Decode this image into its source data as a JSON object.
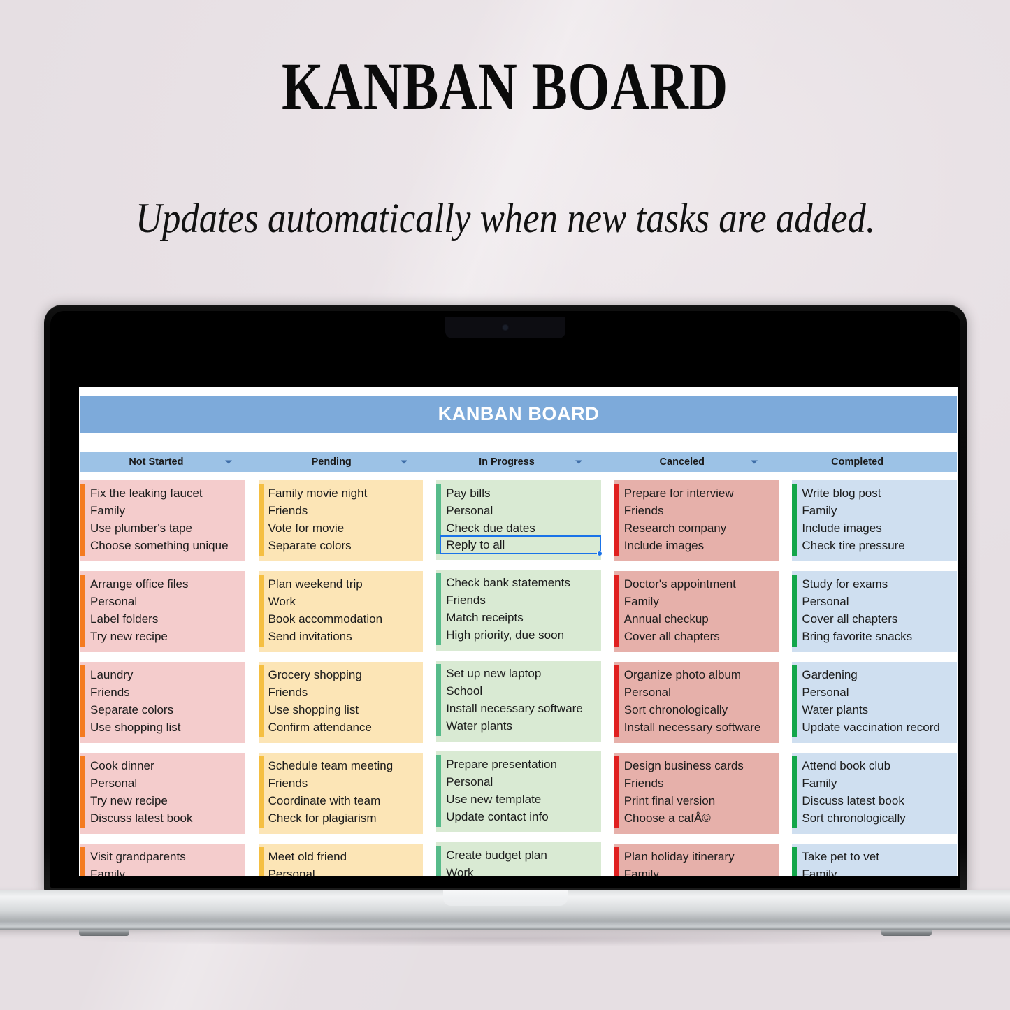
{
  "poster": {
    "title": "KANBAN BOARD",
    "subtitle": "Updates automatically when new tasks are added."
  },
  "device": {
    "type": "laptop",
    "camera_icon": "camera-dot"
  },
  "board": {
    "title": "KANBAN BOARD",
    "title_bar_color": "#7daada",
    "header_bar_color": "#9cc2e6",
    "columns": [
      {
        "name": "Not Started",
        "has_filter": true,
        "card_color": "#f4cccc",
        "accent_color": "#f47b20",
        "cards": [
          {
            "lines": [
              "Fix the leaking faucet",
              "Family",
              "Use plumber's tape",
              "Choose something unique"
            ]
          },
          {
            "lines": [
              "Arrange office files",
              "Personal",
              "Label folders",
              "Try new recipe"
            ]
          },
          {
            "lines": [
              "Laundry",
              "Friends",
              "Separate colors",
              "Use shopping list"
            ]
          },
          {
            "lines": [
              "Cook dinner",
              "Personal",
              "Try new recipe",
              "Discuss latest book"
            ]
          },
          {
            "lines": [
              "Visit grandparents",
              "Family"
            ]
          }
        ]
      },
      {
        "name": "Pending",
        "has_filter": true,
        "card_color": "#fce5b6",
        "accent_color": "#f5bf42",
        "cards": [
          {
            "lines": [
              "Family movie night",
              "Friends",
              "Vote for movie",
              "Separate colors"
            ]
          },
          {
            "lines": [
              "Plan weekend trip",
              "Work",
              "Book accommodation",
              "Send invitations"
            ]
          },
          {
            "lines": [
              "Grocery shopping",
              "Friends",
              "Use shopping list",
              "Confirm attendance"
            ]
          },
          {
            "lines": [
              "Schedule team meeting",
              "Friends",
              "Coordinate with team",
              "Check for plagiarism"
            ]
          },
          {
            "lines": [
              "Meet old friend",
              "Personal"
            ]
          }
        ]
      },
      {
        "name": "In Progress",
        "has_filter": true,
        "card_color": "#d9ead3",
        "accent_color": "#57bb8a",
        "cards": [
          {
            "lines": [
              "Pay bills",
              "Personal",
              "Check due dates",
              "Reply to all"
            ],
            "selected_line": 3
          },
          {
            "lines": [
              "Check bank statements",
              "Friends",
              "Match receipts",
              "High priority, due soon"
            ]
          },
          {
            "lines": [
              "Set up new laptop",
              "School",
              "Install necessary software",
              "Water plants"
            ]
          },
          {
            "lines": [
              "Prepare presentation",
              "Personal",
              "Use new template",
              "Update contact info"
            ]
          },
          {
            "lines": [
              "Create budget plan",
              "Work"
            ]
          }
        ]
      },
      {
        "name": "Canceled",
        "has_filter": true,
        "card_color": "#e6b0aa",
        "accent_color": "#e02020",
        "cards": [
          {
            "lines": [
              "Prepare for interview",
              "Friends",
              "Research company",
              "Include images"
            ]
          },
          {
            "lines": [
              "Doctor's appointment",
              "Family",
              "Annual checkup",
              "Cover all chapters"
            ]
          },
          {
            "lines": [
              "Organize photo album",
              "Personal",
              "Sort chronologically",
              "Install necessary software"
            ]
          },
          {
            "lines": [
              "Design business cards",
              "Friends",
              "Print final version",
              "Choose a cafÅ©"
            ]
          },
          {
            "lines": [
              "Plan holiday itinerary",
              "Family"
            ]
          }
        ]
      },
      {
        "name": "Completed",
        "has_filter": false,
        "card_color": "#cfdff0",
        "accent_color": "#13a64a",
        "cards": [
          {
            "lines": [
              "Write blog post",
              "Family",
              "Include images",
              "Check tire pressure"
            ]
          },
          {
            "lines": [
              "Study for exams",
              "Personal",
              "Cover all chapters",
              "Bring favorite snacks"
            ]
          },
          {
            "lines": [
              "Gardening",
              "Personal",
              "Water plants",
              "Update vaccination record"
            ]
          },
          {
            "lines": [
              "Attend book club",
              "Family",
              "Discuss latest book",
              "Sort chronologically"
            ]
          },
          {
            "lines": [
              "Take pet to vet",
              "Family"
            ]
          }
        ]
      }
    ]
  }
}
